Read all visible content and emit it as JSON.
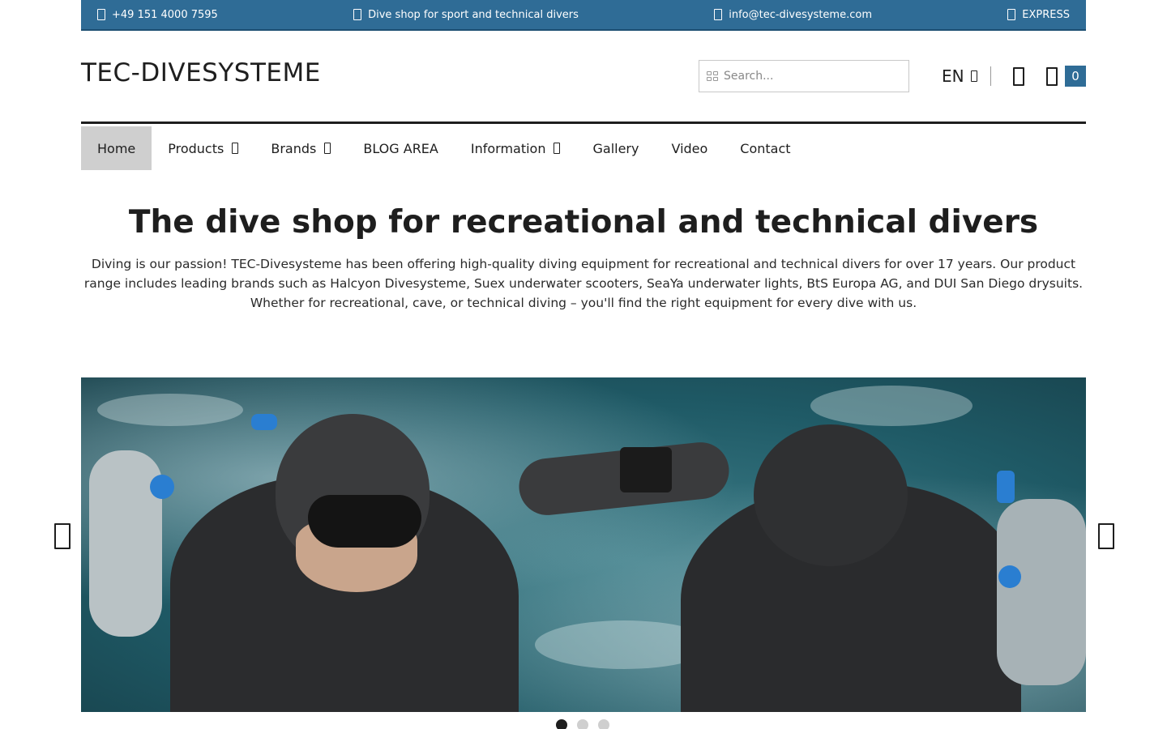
{
  "topbar": {
    "phone": "+49 151 4000 7595",
    "tagline": "Dive shop for sport and technical divers",
    "email": "info@tec-divesysteme.com",
    "express": "EXPRESS",
    "bg_color": "#2f6c96"
  },
  "header": {
    "logo": "TEC-DIVESYSTEME",
    "search_placeholder": "Search...",
    "language": "EN",
    "cart_count": "0",
    "icons": [
      "grid-icon",
      "chevron-down-icon",
      "user-icon",
      "cart-icon"
    ]
  },
  "nav": {
    "items": [
      {
        "label": "Home",
        "active": true
      },
      {
        "label": "Products",
        "dropdown": true
      },
      {
        "label": "Brands",
        "dropdown": true
      },
      {
        "label": "BLOG AREA"
      },
      {
        "label": "Information",
        "dropdown": true
      },
      {
        "label": "Gallery"
      },
      {
        "label": "Video"
      },
      {
        "label": "Contact"
      }
    ]
  },
  "hero": {
    "title": "The dive shop for recreational and technical divers",
    "intro": "Diving is our passion! TEC-Divesysteme has been offering high-quality diving equipment for recreational and technical divers for over 17 years. Our product range includes leading brands such as Halcyon Divesysteme, Suex underwater scooters, SeaYa underwater lights, BtS Europa AG, and DUI San Diego drysuits. Whether for recreational, cave, or technical diving – you'll find the right equipment for every dive with us."
  },
  "slider": {
    "slide_count": 3,
    "active_slide": 1,
    "image_label": "Two technical divers in drysuits at the water surface",
    "accent_color": "#2a7ed1"
  }
}
